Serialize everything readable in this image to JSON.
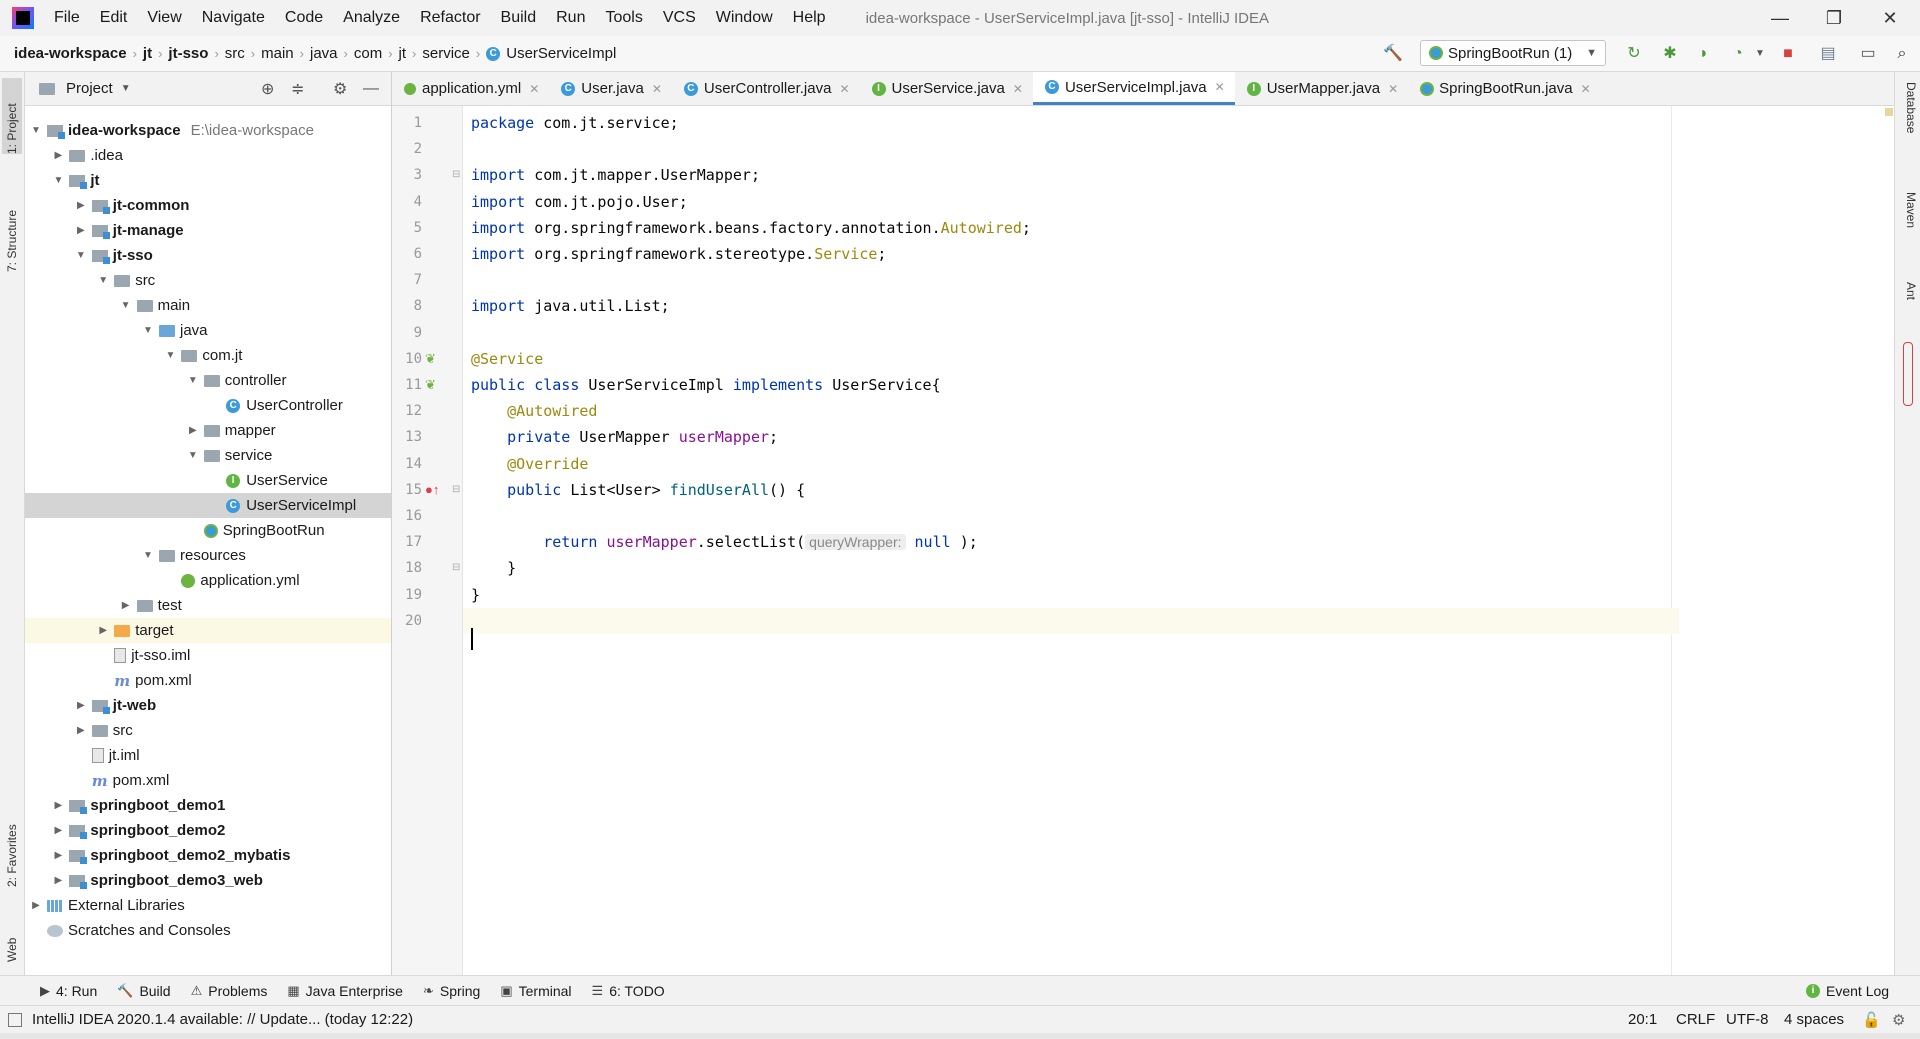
{
  "menu": {
    "items": [
      "File",
      "Edit",
      "View",
      "Navigate",
      "Code",
      "Analyze",
      "Refactor",
      "Build",
      "Run",
      "Tools",
      "VCS",
      "Window",
      "Help"
    ],
    "window_title": "idea-workspace - UserServiceImpl.java [jt-sso] - IntelliJ IDEA"
  },
  "window_controls": {
    "minimize": "—",
    "restore": "❐",
    "close": "✕"
  },
  "breadcrumbs": [
    "idea-workspace",
    "jt",
    "jt-sso",
    "src",
    "main",
    "java",
    "com",
    "jt",
    "service",
    "UserServiceImpl"
  ],
  "run_config": {
    "label": "SpringBootRun (1)"
  },
  "project_panel": {
    "title": "Project",
    "tree": [
      {
        "label": "idea-workspace",
        "hint": "E:\\idea-workspace",
        "depth": 0,
        "arrow": "open",
        "icon": "module",
        "bold": true
      },
      {
        "label": ".idea",
        "depth": 1,
        "arrow": "closed",
        "icon": "folder"
      },
      {
        "label": "jt",
        "depth": 1,
        "arrow": "open",
        "icon": "module",
        "bold": true
      },
      {
        "label": "jt-common",
        "depth": 2,
        "arrow": "closed",
        "icon": "module",
        "bold": true
      },
      {
        "label": "jt-manage",
        "depth": 2,
        "arrow": "closed",
        "icon": "module",
        "bold": true
      },
      {
        "label": "jt-sso",
        "depth": 2,
        "arrow": "open",
        "icon": "module",
        "bold": true
      },
      {
        "label": "src",
        "depth": 3,
        "arrow": "open",
        "icon": "folder"
      },
      {
        "label": "main",
        "depth": 4,
        "arrow": "open",
        "icon": "folder"
      },
      {
        "label": "java",
        "depth": 5,
        "arrow": "open",
        "icon": "folder-blue"
      },
      {
        "label": "com.jt",
        "depth": 6,
        "arrow": "open",
        "icon": "folder"
      },
      {
        "label": "controller",
        "depth": 7,
        "arrow": "open",
        "icon": "folder"
      },
      {
        "label": "UserController",
        "depth": 8,
        "arrow": "none",
        "icon": "class"
      },
      {
        "label": "mapper",
        "depth": 7,
        "arrow": "closed",
        "icon": "folder"
      },
      {
        "label": "service",
        "depth": 7,
        "arrow": "open",
        "icon": "folder"
      },
      {
        "label": "UserService",
        "depth": 8,
        "arrow": "none",
        "icon": "interface"
      },
      {
        "label": "UserServiceImpl",
        "depth": 8,
        "arrow": "none",
        "icon": "class",
        "selected": true
      },
      {
        "label": "SpringBootRun",
        "depth": 7,
        "arrow": "none",
        "icon": "springboot"
      },
      {
        "label": "resources",
        "depth": 5,
        "arrow": "open",
        "icon": "folder"
      },
      {
        "label": "application.yml",
        "depth": 6,
        "arrow": "none",
        "icon": "yml"
      },
      {
        "label": "test",
        "depth": 4,
        "arrow": "closed",
        "icon": "folder"
      },
      {
        "label": "target",
        "depth": 3,
        "arrow": "closed",
        "icon": "folder-orange",
        "excluded": true
      },
      {
        "label": "jt-sso.iml",
        "depth": 3,
        "arrow": "none",
        "icon": "file"
      },
      {
        "label": "pom.xml",
        "depth": 3,
        "arrow": "none",
        "icon": "maven"
      },
      {
        "label": "jt-web",
        "depth": 2,
        "arrow": "closed",
        "icon": "module",
        "bold": true
      },
      {
        "label": "src",
        "depth": 2,
        "arrow": "closed",
        "icon": "folder"
      },
      {
        "label": "jt.iml",
        "depth": 2,
        "arrow": "none",
        "icon": "file"
      },
      {
        "label": "pom.xml",
        "depth": 2,
        "arrow": "none",
        "icon": "maven"
      },
      {
        "label": "springboot_demo1",
        "depth": 1,
        "arrow": "closed",
        "icon": "module",
        "bold": true
      },
      {
        "label": "springboot_demo2",
        "depth": 1,
        "arrow": "closed",
        "icon": "module",
        "bold": true
      },
      {
        "label": "springboot_demo2_mybatis",
        "depth": 1,
        "arrow": "closed",
        "icon": "module",
        "bold": true
      },
      {
        "label": "springboot_demo3_web",
        "depth": 1,
        "arrow": "closed",
        "icon": "module",
        "bold": true
      },
      {
        "label": "External Libraries",
        "depth": 0,
        "arrow": "closed",
        "icon": "libraries"
      },
      {
        "label": "Scratches and Consoles",
        "depth": 0,
        "arrow": "none",
        "icon": "scratches"
      }
    ]
  },
  "editor_tabs": [
    {
      "label": "application.yml",
      "icon": "yml"
    },
    {
      "label": "User.java",
      "icon": "class"
    },
    {
      "label": "UserController.java",
      "icon": "class"
    },
    {
      "label": "UserService.java",
      "icon": "interface"
    },
    {
      "label": "UserServiceImpl.java",
      "icon": "class",
      "active": true
    },
    {
      "label": "UserMapper.java",
      "icon": "interface"
    },
    {
      "label": "SpringBootRun.java",
      "icon": "springboot"
    }
  ],
  "code_lines": [
    [
      [
        "kw",
        "package"
      ],
      [
        "",
        "com.jt.service;"
      ]
    ],
    [],
    [
      [
        "kw",
        "import"
      ],
      [
        "",
        "com.jt.mapper.UserMapper;"
      ]
    ],
    [
      [
        "kw",
        "import"
      ],
      [
        "",
        "com.jt.pojo.User;"
      ]
    ],
    [
      [
        "kw",
        "import"
      ],
      [
        "",
        "org.springframework.beans.factory.annotation."
      ],
      [
        "ann",
        "Autowired"
      ],
      [
        "",
        ";"
      ]
    ],
    [
      [
        "kw",
        "import"
      ],
      [
        "",
        "org.springframework.stereotype."
      ],
      [
        "ann",
        "Service"
      ],
      [
        "",
        ";"
      ]
    ],
    [],
    [
      [
        "kw",
        "import"
      ],
      [
        "",
        "java.util.List;"
      ]
    ],
    [],
    [
      [
        "ann",
        "@Service"
      ]
    ],
    [
      [
        "kw",
        "public class"
      ],
      [
        "",
        "UserServiceImpl"
      ],
      [
        "kw",
        "implements"
      ],
      [
        "",
        "UserService{"
      ]
    ],
    [
      [
        "ind",
        "    "
      ],
      [
        "ann",
        "@Autowired"
      ]
    ],
    [
      [
        "ind",
        "    "
      ],
      [
        "kw",
        "private"
      ],
      [
        "",
        "UserMapper"
      ],
      [
        "fld",
        "userMapper"
      ],
      [
        "",
        ";"
      ]
    ],
    [
      [
        "ind",
        "    "
      ],
      [
        "ann",
        "@Override"
      ]
    ],
    [
      [
        "ind",
        "    "
      ],
      [
        "kw",
        "public"
      ],
      [
        "",
        "List<User>"
      ],
      [
        "mth",
        "findUserAll"
      ],
      [
        "",
        "() {"
      ]
    ],
    [],
    [
      [
        "ind",
        "        "
      ],
      [
        "kw",
        "return"
      ],
      [
        "fld",
        "userMapper"
      ],
      [
        "",
        ".selectList("
      ],
      [
        "hint",
        "queryWrapper:"
      ],
      [
        "kw",
        "null"
      ],
      [
        "",
        ");"
      ]
    ],
    [
      [
        "ind",
        "    "
      ],
      [
        "",
        "}"
      ]
    ],
    [
      [
        "",
        "}"
      ]
    ],
    []
  ],
  "bottom_tools": [
    {
      "label": "4: Run",
      "icon": "▶"
    },
    {
      "label": "Build",
      "icon": "🔨"
    },
    {
      "label": "Problems",
      "icon": "⚠"
    },
    {
      "label": "Java Enterprise",
      "icon": "▦"
    },
    {
      "label": "Spring",
      "icon": "❧"
    },
    {
      "label": "Terminal",
      "icon": "▣"
    },
    {
      "label": "6: TODO",
      "icon": "☰"
    }
  ],
  "event_log": "Event Log",
  "status": {
    "message": "IntelliJ IDEA 2020.1.4 available: // Update... (today 12:22)",
    "position": "20:1",
    "line_sep": "CRLF",
    "encoding": "UTF-8",
    "indent": "4 spaces"
  },
  "left_stripe": {
    "project": "1: Project",
    "structure": "7: Structure",
    "favorites": "2: Favorites",
    "web": "Web"
  },
  "right_stripe": {
    "database": "Database",
    "maven": "Maven",
    "ant": "Ant"
  }
}
